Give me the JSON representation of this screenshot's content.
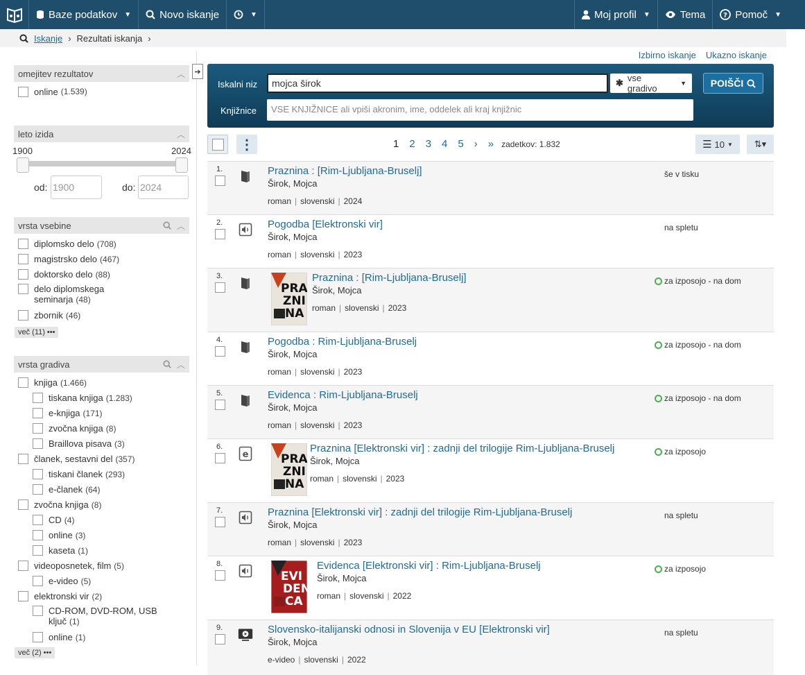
{
  "nav": {
    "databases": "Baze podatkov",
    "new_search": "Novo iskanje",
    "profile": "Moj profil",
    "theme": "Tema",
    "help": "Pomoč"
  },
  "breadcrumb": {
    "search": "Iskanje",
    "results": "Rezultati iskanja"
  },
  "links": {
    "selective": "Izbirno iskanje",
    "advanced": "Ukazno iskanje"
  },
  "search": {
    "string_label": "Iskalni niz",
    "query": "mojca širok",
    "material": "vse gradivo",
    "button": "POIŠČI",
    "libraries_label": "Knjižnice",
    "libraries_placeholder": "VSE KNJIŽNICE ali vpiši akronim, ime, oddelek ali kraj knjižnic"
  },
  "facets": {
    "limit": {
      "title": "omejitev rezultatov",
      "items": [
        {
          "label": "online",
          "count": "(1.539)"
        }
      ]
    },
    "year": {
      "title": "leto izida",
      "min": "1900",
      "max": "2024",
      "from_label": "od:",
      "from_placeholder": "1900",
      "to_label": "do:",
      "to_placeholder": "2024"
    },
    "content": {
      "title": "vrsta vsebine",
      "items": [
        {
          "label": "diplomsko delo",
          "count": "(708)"
        },
        {
          "label": "magistrsko delo",
          "count": "(467)"
        },
        {
          "label": "doktorsko delo",
          "count": "(88)"
        },
        {
          "label": "delo diplomskega seminarja",
          "count": "(48)"
        },
        {
          "label": "zbornik",
          "count": "(46)"
        }
      ],
      "more": "več (11)"
    },
    "material": {
      "title": "vrsta gradiva",
      "items": [
        {
          "label": "knjiga",
          "count": "(1.466)",
          "sub": false
        },
        {
          "label": "tiskana knjiga",
          "count": "(1.283)",
          "sub": true
        },
        {
          "label": "e-knjiga",
          "count": "(171)",
          "sub": true
        },
        {
          "label": "zvočna knjiga",
          "count": "(8)",
          "sub": true
        },
        {
          "label": "Braillova pisava",
          "count": "(3)",
          "sub": true
        },
        {
          "label": "članek, sestavni del",
          "count": "(357)",
          "sub": false
        },
        {
          "label": "tiskani članek",
          "count": "(293)",
          "sub": true
        },
        {
          "label": "e-članek",
          "count": "(64)",
          "sub": true
        },
        {
          "label": "zvočna knjiga",
          "count": "(8)",
          "sub": false
        },
        {
          "label": "CD",
          "count": "(4)",
          "sub": true
        },
        {
          "label": "online",
          "count": "(3)",
          "sub": true
        },
        {
          "label": "kaseta",
          "count": "(1)",
          "sub": true
        },
        {
          "label": "videoposnetek, film",
          "count": "(5)",
          "sub": false
        },
        {
          "label": "e-video",
          "count": "(5)",
          "sub": true
        },
        {
          "label": "elektronski vir",
          "count": "(2)",
          "sub": false
        },
        {
          "label": "CD-ROM, DVD-ROM, USB ključ",
          "count": "(1)",
          "sub": true
        },
        {
          "label": "online",
          "count": "(1)",
          "sub": true
        }
      ],
      "more": "več (2)"
    }
  },
  "toolbar": {
    "pages": [
      "1",
      "2",
      "3",
      "4",
      "5"
    ],
    "next": "›",
    "last": "»",
    "total": "zadetkov: 1.832",
    "per_page": "10"
  },
  "results": [
    {
      "num": "1.",
      "icon": "book",
      "title": "Praznina : [Rim-Ljubljana-Bruselj]",
      "author": "Širok, Mojca",
      "type": "roman",
      "lang": "slovenski",
      "year": "2024",
      "status": "še v tisku",
      "available": false,
      "cover": false
    },
    {
      "num": "2.",
      "icon": "audio",
      "title": "Pogodba [Elektronski vir]",
      "author": "Širok, Mojca",
      "type": "roman",
      "lang": "slovenski",
      "year": "2023",
      "status": "na spletu",
      "available": false,
      "cover": false
    },
    {
      "num": "3.",
      "icon": "book",
      "title": "Praznina : [Rim-Ljubljana-Bruselj]",
      "author": "Širok, Mojca",
      "type": "roman",
      "lang": "slovenski",
      "year": "2023",
      "status": "za izposojo - na dom",
      "available": true,
      "cover": true,
      "cover_text": "PRAZNINA"
    },
    {
      "num": "4.",
      "icon": "book",
      "title": "Pogodba : Rim-Ljubljana-Bruselj",
      "author": "Širok, Mojca",
      "type": "roman",
      "lang": "slovenski",
      "year": "2023",
      "status": "za izposojo - na dom",
      "available": true,
      "cover": false
    },
    {
      "num": "5.",
      "icon": "book",
      "title": "Evidenca : Rim-Ljubljana-Bruselj",
      "author": "Širok, Mojca",
      "type": "roman",
      "lang": "slovenski",
      "year": "2023",
      "status": "za izposojo - na dom",
      "available": true,
      "cover": false
    },
    {
      "num": "6.",
      "icon": "ebook",
      "title": "Praznina [Elektronski vir] : zadnji del trilogije Rim-Ljubljana-Bruselj",
      "author": "Širok, Mojca",
      "type": "roman",
      "lang": "slovenski",
      "year": "2023",
      "status": "za izposojo",
      "available": true,
      "cover": true,
      "cover_text": "PRAZNINA"
    },
    {
      "num": "7.",
      "icon": "audio",
      "title": "Praznina [Elektronski vir] : zadnji del trilogije Rim-Ljubljana-Bruselj",
      "author": "Širok, Mojca",
      "type": "roman",
      "lang": "slovenski",
      "year": "2023",
      "status": "na spletu",
      "available": false,
      "cover": false
    },
    {
      "num": "8.",
      "icon": "audio",
      "title": "Evidenca [Elektronski vir] : Rim-Ljubljana-Bruselj",
      "author": "Širok, Mojca",
      "type": "roman",
      "lang": "slovenski",
      "year": "2022",
      "status": "za izposojo",
      "available": true,
      "cover": true,
      "cover_text": "EVIDENCA"
    },
    {
      "num": "9.",
      "icon": "video",
      "title": "Slovensko-italijanski odnosi in Slovenija v EU [Elektronski vir]",
      "author": "Širok, Mojca",
      "type": "e-video",
      "lang": "slovenski",
      "year": "2022",
      "status": "na spletu",
      "available": false,
      "cover": false
    }
  ],
  "colors": {
    "nav": "#1f4e6d",
    "link": "#1f6b9a",
    "available": "#4caf50"
  }
}
